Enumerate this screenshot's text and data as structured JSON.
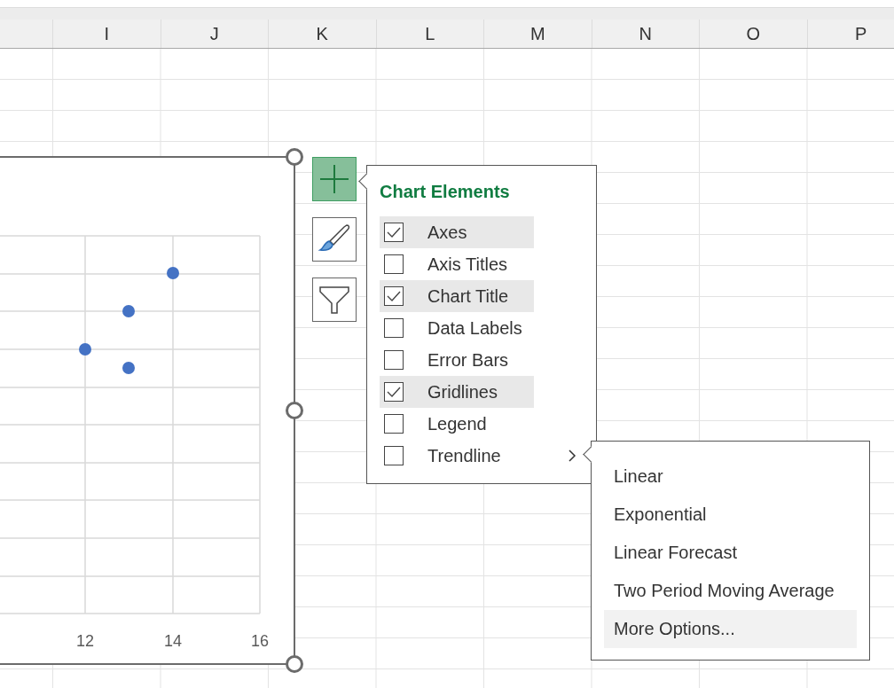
{
  "columns": [
    "I",
    "J",
    "K",
    "L",
    "M",
    "N",
    "O",
    "P"
  ],
  "chart": {
    "x_tick_labels": [
      "12",
      "14",
      "16"
    ]
  },
  "chart_buttons": [
    {
      "kind": "elements",
      "selected": true
    },
    {
      "kind": "styles",
      "selected": false
    },
    {
      "kind": "filters",
      "selected": false
    }
  ],
  "chart_elements": {
    "title": "Chart Elements",
    "items": [
      {
        "label": "Axes",
        "checked": true
      },
      {
        "label": "Axis Titles",
        "checked": false
      },
      {
        "label": "Chart Title",
        "checked": true
      },
      {
        "label": "Data Labels",
        "checked": false
      },
      {
        "label": "Error Bars",
        "checked": false
      },
      {
        "label": "Gridlines",
        "checked": true
      },
      {
        "label": "Legend",
        "checked": false
      },
      {
        "label": "Trendline",
        "checked": false,
        "expanded": true,
        "submenu": [
          {
            "label": "Linear",
            "selected": false
          },
          {
            "label": "Exponential",
            "selected": false
          },
          {
            "label": "Linear Forecast",
            "selected": false
          },
          {
            "label": "Two Period Moving Average",
            "selected": false
          },
          {
            "label": "More Options...",
            "selected": true
          }
        ]
      }
    ]
  }
}
